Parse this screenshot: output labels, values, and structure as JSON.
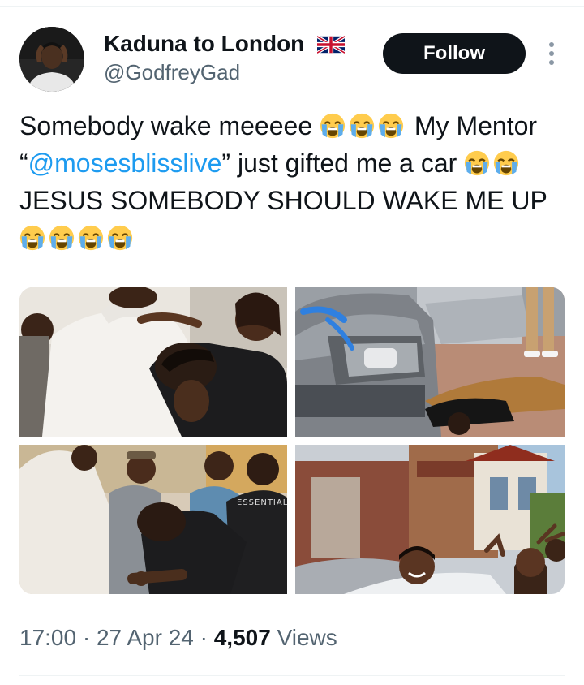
{
  "profile": {
    "display_name": "Kaduna to London",
    "flag_icon": "uk-flag-icon",
    "handle": "@GodfreyGad"
  },
  "actions": {
    "follow_label": "Follow",
    "more_icon": "more-vertical-icon"
  },
  "tweet": {
    "segment_1": "Somebody wake meeeee ",
    "segment_2": " My Mentor “",
    "mention": "@mosesblisslive",
    "segment_3": "” just gifted me a car ",
    "segment_4": " JESUS SOMEBODY SHOULD WAKE ME UP ",
    "emoji_icon": "loudly-crying-face-icon"
  },
  "media": {
    "photo_3_shirt_text": "ESSENTIALS"
  },
  "meta": {
    "time": "17:00",
    "date": "27 Apr 24",
    "views_count": "4,507",
    "views_label": "Views",
    "separator": "·"
  },
  "colors": {
    "text": "#0f1419",
    "secondary": "#536471",
    "link": "#1d9bf0",
    "button_bg": "#0f1419"
  }
}
